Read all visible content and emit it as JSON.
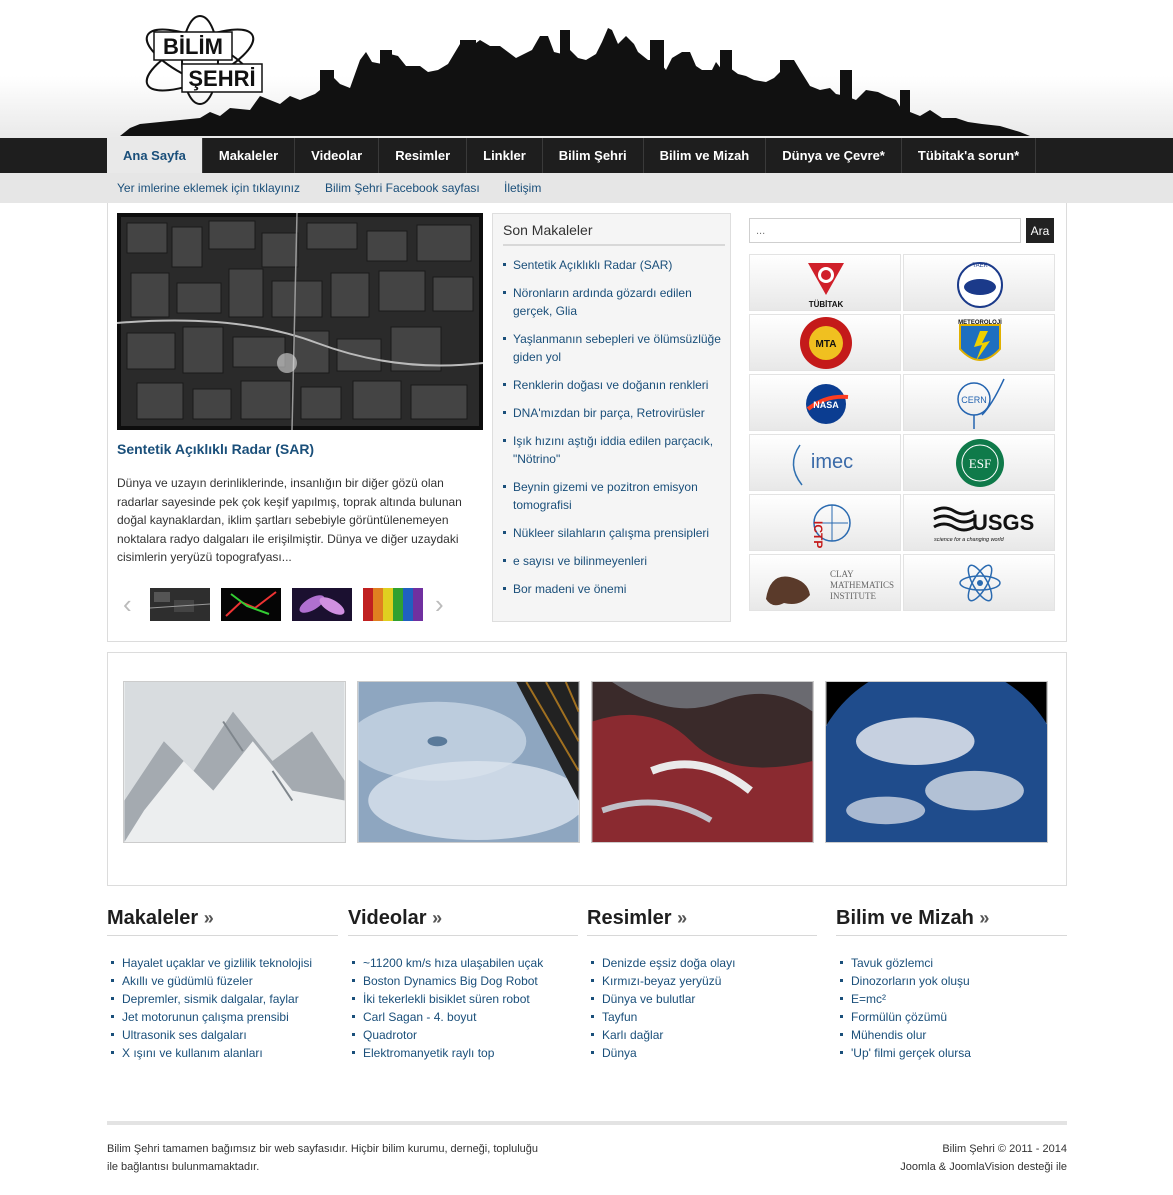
{
  "header": {
    "logo_line1": "BİLİM",
    "logo_line2": "ŞEHRİ"
  },
  "mainnav": {
    "items": [
      {
        "label": "Ana Sayfa",
        "active": true
      },
      {
        "label": "Makaleler"
      },
      {
        "label": "Videolar"
      },
      {
        "label": "Resimler"
      },
      {
        "label": "Linkler"
      },
      {
        "label": "Bilim Şehri"
      },
      {
        "label": "Bilim ve Mizah"
      },
      {
        "label": "Dünya ve Çevre*"
      },
      {
        "label": "Tübitak'a sorun*"
      }
    ]
  },
  "subnav": {
    "items": [
      {
        "label": "Yer imlerine eklemek için tıklayınız"
      },
      {
        "label": "Bilim Şehri Facebook sayfası"
      },
      {
        "label": "İletişim"
      }
    ]
  },
  "featured": {
    "title": "Sentetik Açıklıklı Radar (SAR)",
    "text": "Dünya ve uzayın derinliklerinde, insanlığın bir diğer gözü olan radarlar sayesinde pek çok keşif yapılmış, toprak altında bulunan doğal kaynaklardan, iklim şartları sebebiyle görüntülenemeyen noktalara radyo dalgaları ile erişilmiştir. Dünya ve diğer uzaydaki cisimlerin yeryüzü topografyası...",
    "prev_arrow": "‹",
    "next_arrow": "›"
  },
  "latest": {
    "title": "Son Makaleler",
    "items": [
      "Sentetik Açıklıklı Radar (SAR)",
      "Nöronların ardında gözardı edilen gerçek, Glia",
      "Yaşlanmanın sebepleri ve ölümsüzlüğe giden yol",
      "Renklerin doğası ve doğanın renkleri",
      "DNA'mızdan bir parça, Retrovirüsler",
      "Işık hızını aştığı iddia edilen parçacık, \"Nötrino\"",
      "Beynin gizemi ve pozitron emisyon tomografisi",
      "Nükleer silahların çalışma prensipleri",
      "e sayısı ve bilinmeyenleri",
      "Bor madeni ve önemi"
    ]
  },
  "search": {
    "placeholder": "...",
    "button": "Ara"
  },
  "partners": {
    "tubitak": "TÜBİTAK",
    "taek": "TAEK",
    "mta": "MTA",
    "meteoroloji": "METEOROLOJİ",
    "nasa": "NASA",
    "cern": "CERN",
    "imec": "imec",
    "esf": "ESF",
    "ictp": "ICTP",
    "usgs": "USGS",
    "usgs_tag": "science for a changing world",
    "clay1": "CLAY",
    "clay2": "MATHEMATICS",
    "clay3": "INSTITUTE"
  },
  "columns": [
    {
      "title": "Makaleler",
      "items": [
        "Hayalet uçaklar ve gizlilik teknolojisi",
        "Akıllı ve güdümlü füzeler",
        "Depremler, sismik dalgalar, faylar",
        "Jet motorunun çalışma prensibi",
        "Ultrasonik ses dalgaları",
        "X ışını ve kullanım alanları"
      ]
    },
    {
      "title": "Videolar",
      "items": [
        "~11200 km/s hıza ulaşabilen uçak",
        "Boston Dynamics Big Dog Robot",
        "İki tekerlekli bisiklet süren robot",
        "Carl Sagan - 4. boyut",
        "Quadrotor",
        "Elektromanyetik raylı top"
      ]
    },
    {
      "title": "Resimler",
      "items": [
        "Denizde eşsiz doğa olayı",
        "Kırmızı-beyaz yeryüzü",
        "Dünya ve bulutlar",
        "Tayfun",
        "Karlı dağlar",
        "Dünya"
      ]
    },
    {
      "title": "Bilim ve Mizah",
      "items": [
        "Tavuk gözlemci",
        "Dinozorların yok oluşu",
        "E=mc²",
        "Formülün çözümü",
        "Mühendis olur",
        "'Up' filmi gerçek olursa"
      ]
    }
  ],
  "chevron": "»",
  "footer": {
    "left_line1": "Bilim Şehri tamamen bağımsız bir web sayfasıdır. Hiçbir bilim kurumu, derneği, topluluğu",
    "left_line2": "ile bağlantısı bulunmamaktadır.",
    "right_line1": "Bilim Şehri © 2011 - 2014",
    "right_line2": "Joomla & JoomlaVision desteği ile"
  },
  "colors": {
    "link": "#1a4f7a",
    "nav_bg": "#1e1e1e",
    "subnav_bg": "#e6e6e6"
  }
}
